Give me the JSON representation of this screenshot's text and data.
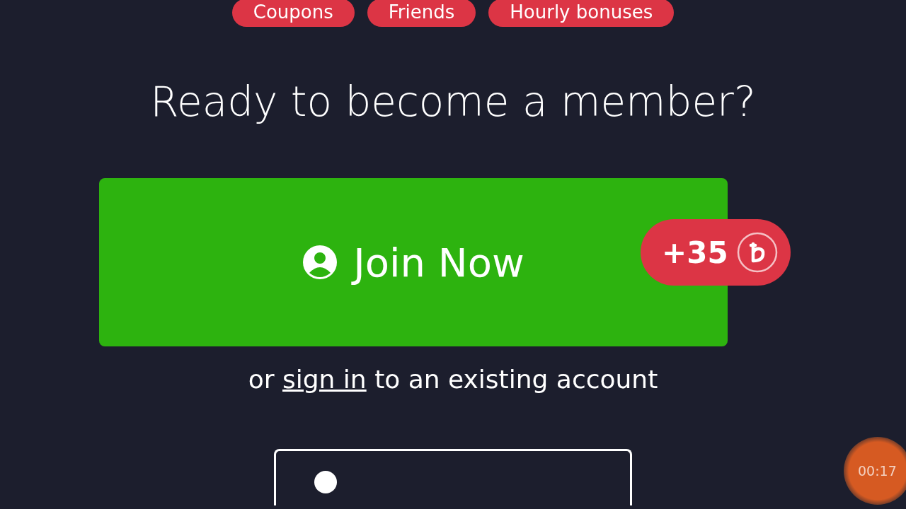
{
  "categories": [
    {
      "label": "Coupons"
    },
    {
      "label": "Friends"
    },
    {
      "label": "Hourly bonuses"
    }
  ],
  "heading": "Ready to become a member?",
  "join_button": {
    "label": "Join Now",
    "reward": "+35"
  },
  "sign_in_line": {
    "before": "or",
    "link": "sign in",
    "after": "to an existing account"
  },
  "timer": "00:17"
}
